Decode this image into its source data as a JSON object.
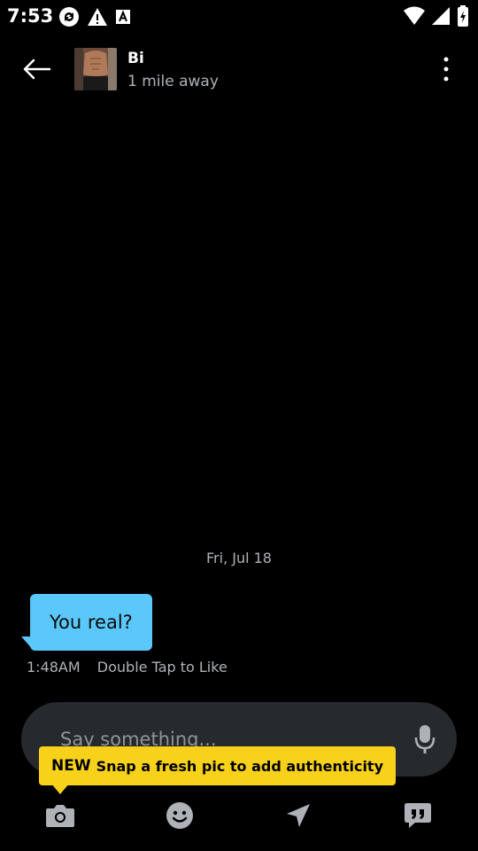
{
  "status_bar": {
    "time": "7:53",
    "left_icons": [
      "sync-icon",
      "warning-icon",
      "font-a-icon"
    ],
    "right_icons": [
      "wifi-icon",
      "signal-icon",
      "battery-icon"
    ]
  },
  "header": {
    "name": "Bi",
    "distance": "1 mile away"
  },
  "conversation": {
    "date_separator": "Fri, Jul 18",
    "messages": [
      {
        "text": "You real?",
        "time": "1:48AM",
        "like_hint": "Double Tap to Like",
        "bubble_color": "#5ac8fa"
      }
    ]
  },
  "composer": {
    "placeholder": "Say something..."
  },
  "tooltip": {
    "badge": "NEW",
    "text": "Snap a fresh pic to add authenticity",
    "color": "#f8d21a"
  },
  "bottom_bar": {
    "icons": [
      "camera-icon",
      "smiley-icon",
      "location-arrow-icon",
      "quote-chat-icon"
    ]
  },
  "colors": {
    "background": "#000000",
    "muted_text": "#aeb2b8",
    "input_bg": "#26292d"
  }
}
